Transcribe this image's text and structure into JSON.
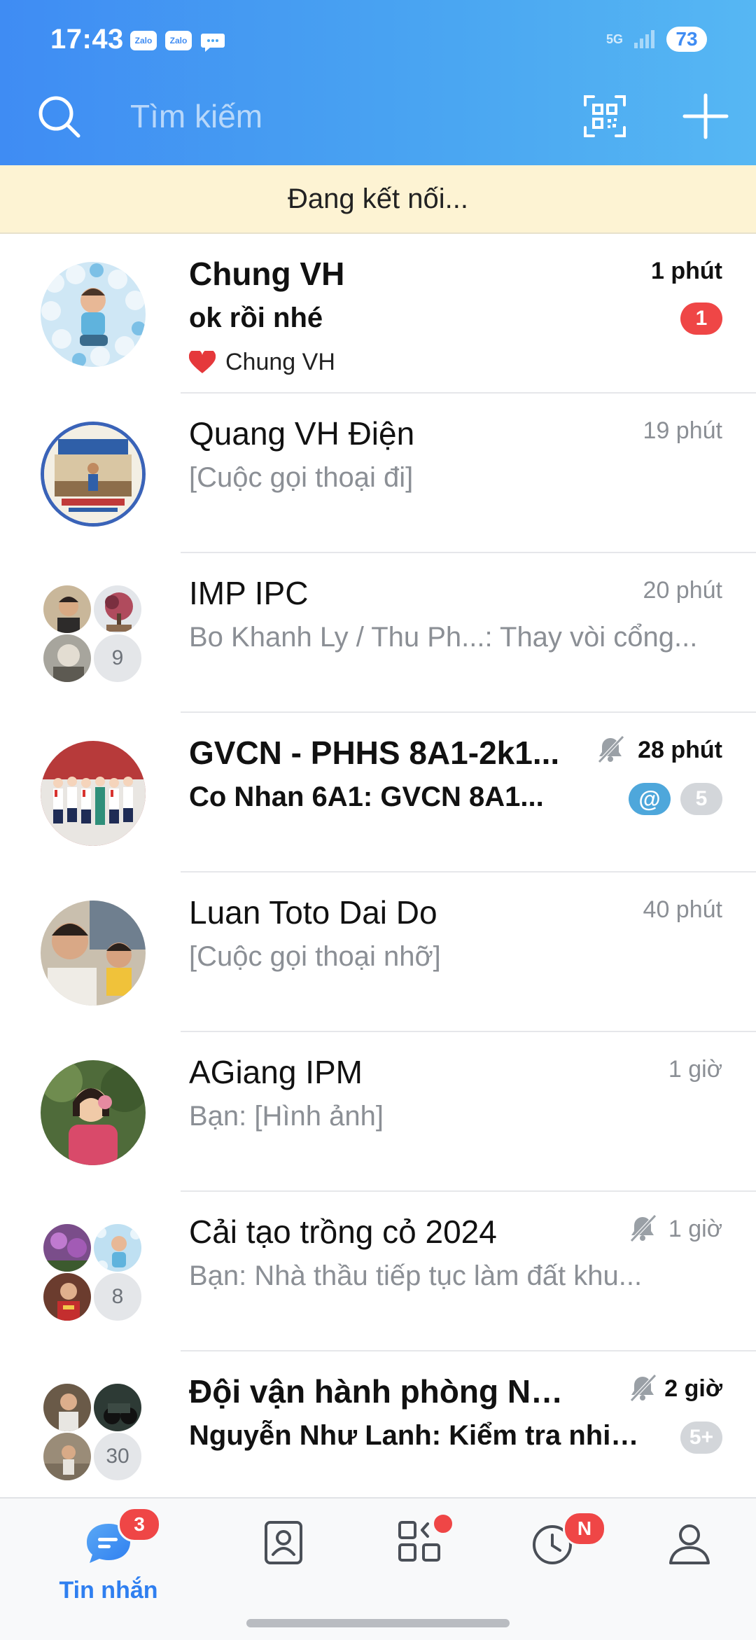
{
  "status_bar": {
    "time": "17:43",
    "notification_icons": [
      "Zalo",
      "Zalo",
      "chat-bubble-icon"
    ],
    "network": "5G",
    "battery": "73"
  },
  "search": {
    "placeholder": "Tìm kiếm"
  },
  "banner": {
    "text": "Đang kết nối..."
  },
  "conversations": [
    {
      "name": "Chung VH",
      "preview": "ok rồi nhé",
      "sub_line": "Chung VH",
      "time": "1 phút",
      "badge": "1",
      "unread": true
    },
    {
      "name": "Quang VH Điện",
      "preview": "[Cuộc gọi thoại đi]",
      "time": "19 phút",
      "unread": false
    },
    {
      "name": "IMP IPC",
      "preview": "Bo Khanh Ly / Thu Ph...: Thay vòi cổng...",
      "time": "20 phút",
      "member_count": "9",
      "unread": false
    },
    {
      "name": "GVCN - PHHS 8A1-2k1...",
      "preview": "Co Nhan 6A1: GVCN 8A1...",
      "time": "28 phút",
      "mention": "@",
      "badge": "5",
      "muted": true,
      "unread": true
    },
    {
      "name": "Luan Toto Dai Do",
      "preview": "[Cuộc gọi thoại nhỡ]",
      "time": "40 phút",
      "unread": false
    },
    {
      "name": "AGiang IPM",
      "preview": "Bạn: [Hình ảnh]",
      "time": "1 giờ",
      "unread": false
    },
    {
      "name": "Cải tạo trồng cỏ 2024",
      "preview": "Bạn: Nhà thầu tiếp tục làm đất khu...",
      "time": "1 giờ",
      "member_count": "8",
      "muted": true,
      "unread": false
    },
    {
      "name": "Đội vận hành phòng Nước",
      "preview": "Nguyễn Như Lanh: Kiểm tra nhiệt...",
      "time": "2 giờ",
      "member_count": "30",
      "badge": "5+",
      "muted": true,
      "unread": true
    }
  ],
  "bottom_nav": {
    "messages_label": "Tin nhắn",
    "messages_badge": "3",
    "timeline_badge": "N",
    "items": [
      "chat-bubble-icon",
      "contacts-icon",
      "apps-grid-icon",
      "timeline-clock-icon",
      "profile-icon"
    ]
  },
  "colors": {
    "header_gradient_start": "#3f8cf3",
    "header_gradient_end": "#56b7f3",
    "badge_red": "#ef4646",
    "mention_blue": "#4ea7db",
    "banner_bg": "#fdf3d3",
    "nav_active": "#2f7ff0"
  }
}
